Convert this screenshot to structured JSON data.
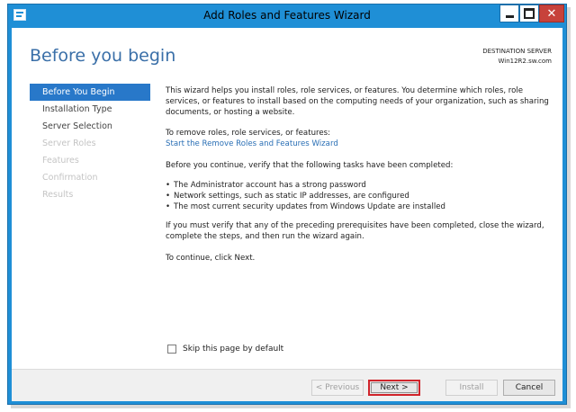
{
  "window": {
    "title": "Add Roles and Features Wizard"
  },
  "header": {
    "page_title": "Before you begin",
    "destination_label": "DESTINATION SERVER",
    "destination_value": "Win12R2.sw.com"
  },
  "nav": {
    "items": [
      {
        "label": "Before You Begin",
        "state": "active"
      },
      {
        "label": "Installation Type",
        "state": "enabled"
      },
      {
        "label": "Server Selection",
        "state": "enabled"
      },
      {
        "label": "Server Roles",
        "state": "disabled"
      },
      {
        "label": "Features",
        "state": "disabled"
      },
      {
        "label": "Confirmation",
        "state": "disabled"
      },
      {
        "label": "Results",
        "state": "disabled"
      }
    ]
  },
  "content": {
    "intro": "This wizard helps you install roles, role services, or features. You determine which roles, role services, or features to install based on the computing needs of your organization, such as sharing documents, or hosting a website.",
    "remove_text": "To remove roles, role services, or features:",
    "remove_link": "Start the Remove Roles and Features Wizard",
    "verify_text": "Before you continue, verify that the following tasks have been completed:",
    "bullets": [
      "The Administrator account has a strong password",
      "Network settings, such as static IP addresses, are configured",
      "The most current security updates from Windows Update are installed"
    ],
    "prereq_text": "If you must verify that any of the preceding prerequisites have been completed, close the wizard, complete the steps, and then run the wizard again.",
    "continue_text": "To continue, click Next."
  },
  "skip": {
    "label": "Skip this page by default",
    "checked": false
  },
  "footer": {
    "previous_label": "< Previous",
    "next_label": "Next >",
    "install_label": "Install",
    "cancel_label": "Cancel"
  },
  "colors": {
    "titlebar": "#1f8fd6",
    "nav_active": "#2878c9",
    "link": "#2a6fb5",
    "highlight": "#d0242b"
  }
}
